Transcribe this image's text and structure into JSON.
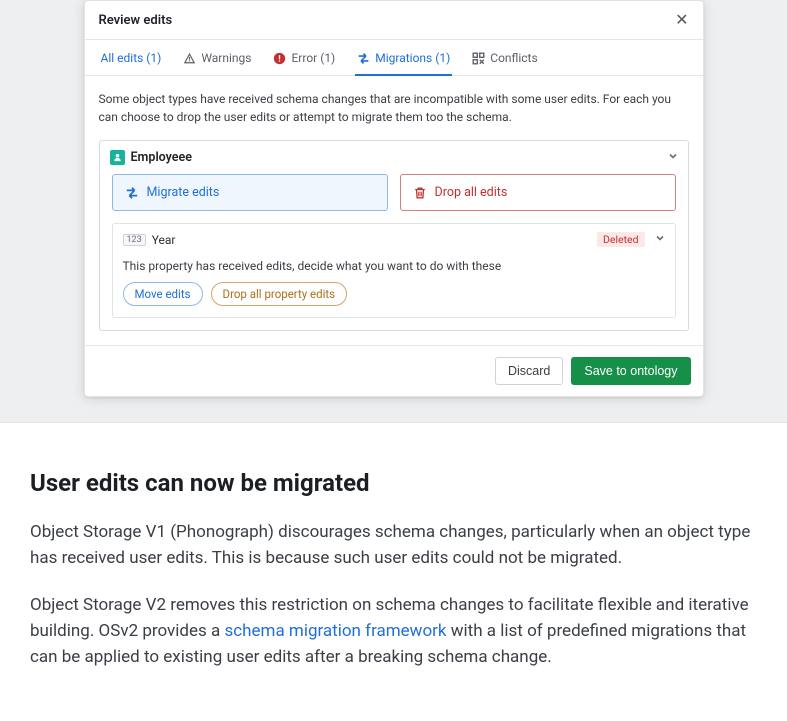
{
  "dialog": {
    "title": "Review edits",
    "tabs": {
      "all": "All edits (1)",
      "warnings": "Warnings",
      "error": "Error (1)",
      "migrations": "Migrations (1)",
      "conflicts": "Conflicts"
    },
    "explain": "Some object types have received schema changes that are incompatible with some user edits. For each you can choose to drop the user edits or attempt to migrate them too the schema.",
    "object": {
      "name": "Employeee",
      "migrate_label": "Migrate edits",
      "drop_label": "Drop all edits",
      "property": {
        "type_chip": "123",
        "name": "Year",
        "badge": "Deleted",
        "body_text": "This property has received edits, decide what you want to do with these",
        "move_btn": "Move edits",
        "dropprop_btn": "Drop all property edits"
      }
    },
    "footer": {
      "discard": "Discard",
      "save": "Save to ontology"
    }
  },
  "doc": {
    "heading": "User edits can now be migrated",
    "p1": "Object Storage V1 (Phonograph) discourages schema changes, particularly when an object type has received user edits. This is because such user edits could not be migrated.",
    "p2_a": "Object Storage V2 removes this restriction on schema changes to facilitate flexible and iterative building. OSv2 provides a ",
    "p2_link": "schema migration framework",
    "p2_b": " with a list of predefined migrations that can be applied to existing user edits after a breaking schema change."
  }
}
